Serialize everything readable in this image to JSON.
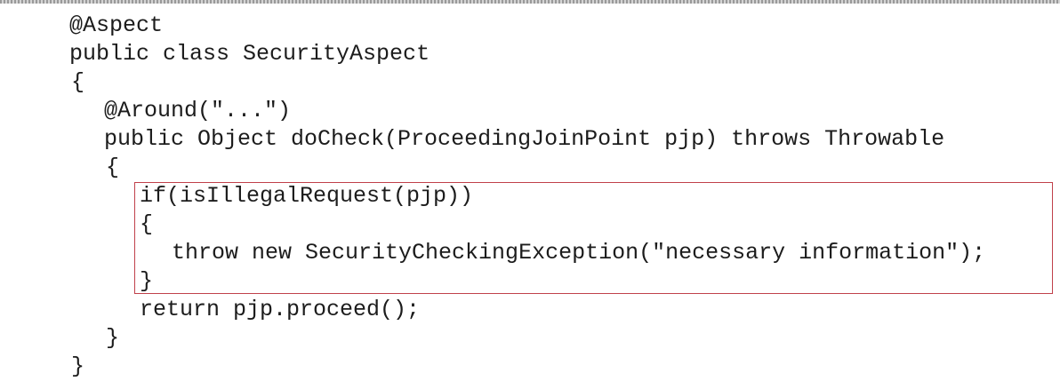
{
  "code": {
    "lines": [
      "@Aspect",
      "public class SecurityAspect",
      "{",
      "@Around(\"...\")",
      "public Object doCheck(ProceedingJoinPoint pjp) throws Throwable",
      "{",
      "if(isIllegalRequest(pjp))",
      "{",
      "throw new SecurityCheckingException(\"necessary information\");",
      "}",
      "return pjp.proceed();",
      "}",
      "}"
    ]
  },
  "colors": {
    "text": "#1c1c1c",
    "highlight_border": "#c0404a",
    "background": "#ffffff"
  }
}
